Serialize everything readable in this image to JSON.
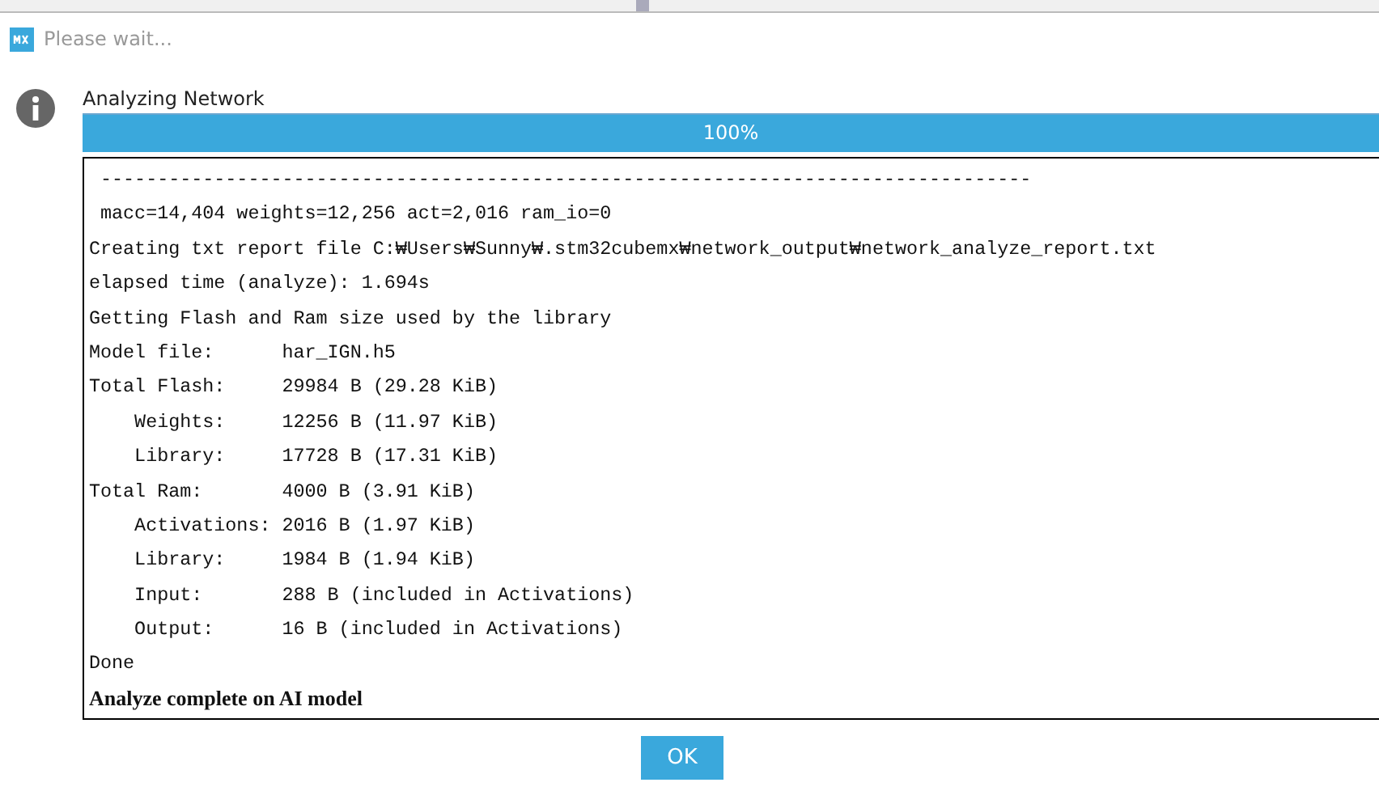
{
  "window": {
    "title": "Please wait..."
  },
  "message": "Analyzing Network",
  "progress": {
    "level": 1.0,
    "reading": "100%"
  },
  "log": [
    {
      "kind": "mono",
      "text": " ----------------------------------------------------------------------------------"
    },
    {
      "kind": "mono",
      "text": " macc=14,404 weights=12,256 act=2,016 ram_io=0"
    },
    {
      "kind": "mono",
      "text": "Creating txt report file C:₩Users₩Sunny₩.stm32cubemx₩network_output₩network_analyze_report.txt"
    },
    {
      "kind": "mono",
      "text": "elapsed time (analyze): 1.694s"
    },
    {
      "kind": "mono",
      "text": "Getting Flash and Ram size used by the library"
    },
    {
      "kind": "mono",
      "text": "Model file:      har_IGN.h5"
    },
    {
      "kind": "mono",
      "text": "Total Flash:     29984 B (29.28 KiB)"
    },
    {
      "kind": "mono",
      "text": "    Weights:     12256 B (11.97 KiB)"
    },
    {
      "kind": "mono",
      "text": "    Library:     17728 B (17.31 KiB)"
    },
    {
      "kind": "mono",
      "text": "Total Ram:       4000 B (3.91 KiB)"
    },
    {
      "kind": "mono",
      "text": "    Activations: 2016 B (1.97 KiB)"
    },
    {
      "kind": "mono",
      "text": "    Library:     1984 B (1.94 KiB)"
    },
    {
      "kind": "mono",
      "text": "    Input:       288 B (included in Activations)"
    },
    {
      "kind": "mono",
      "text": "    Output:      16 B (included in Activations)"
    },
    {
      "kind": "mono",
      "text": "Done"
    },
    {
      "kind": "bold",
      "text": "Analyze complete on AI model"
    }
  ],
  "buttons": [
    "OK"
  ]
}
